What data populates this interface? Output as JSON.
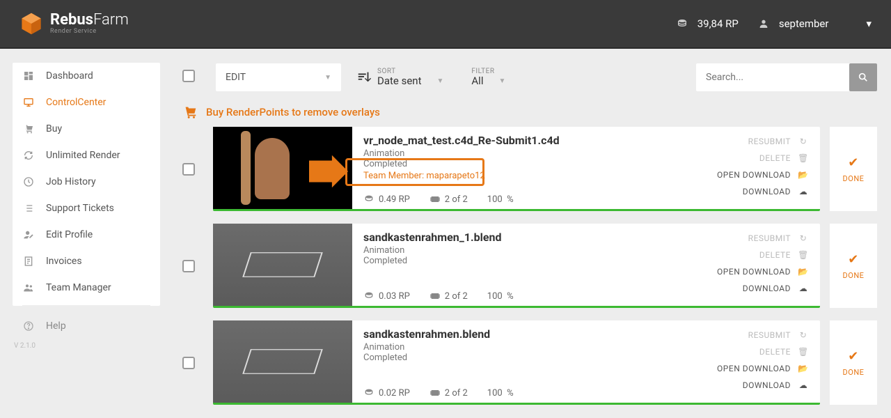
{
  "header": {
    "brand_main": "Rebus",
    "brand_sub": "Farm",
    "brand_tag": "Render Service",
    "balance": "39,84 RP",
    "username": "september"
  },
  "sidebar": {
    "items": [
      {
        "label": "Dashboard",
        "icon": "dashboard"
      },
      {
        "label": "ControlCenter",
        "icon": "monitor",
        "active": true
      },
      {
        "label": "Buy",
        "icon": "cart"
      },
      {
        "label": "Unlimited Render",
        "icon": "cycle"
      },
      {
        "label": "Job History",
        "icon": "history"
      },
      {
        "label": "Support Tickets",
        "icon": "list"
      },
      {
        "label": "Edit Profile",
        "icon": "user-edit"
      },
      {
        "label": "Invoices",
        "icon": "invoice"
      },
      {
        "label": "Team Manager",
        "icon": "team"
      }
    ],
    "help": "Help",
    "version": "V 2.1.0"
  },
  "toolbar": {
    "edit_label": "EDIT",
    "sort_label": "SORT",
    "sort_value": "Date sent",
    "filter_label": "FILTER",
    "filter_value": "All",
    "search_placeholder": "Search..."
  },
  "banner": {
    "text": "Buy RenderPoints to remove overlays"
  },
  "action_labels": {
    "resubmit": "RESUBMIT",
    "delete": "DELETE",
    "open_download": "OPEN DOWNLOAD",
    "download": "DOWNLOAD",
    "done": "DONE"
  },
  "jobs": [
    {
      "title": "vr_node_mat_test.c4d_Re-Submit1.c4d",
      "type": "Animation",
      "status": "Completed",
      "team_member": "Team Member: maparapeto12",
      "rp": "0.49 RP",
      "frames": "2 of 2",
      "progress": "100",
      "unit": "%",
      "thumb": "dark",
      "highlight": true
    },
    {
      "title": "sandkastenrahmen_1.blend",
      "type": "Animation",
      "status": "Completed",
      "team_member": "",
      "rp": "0.03 RP",
      "frames": "2 of 2",
      "progress": "100",
      "unit": "%",
      "thumb": "gray",
      "highlight": false
    },
    {
      "title": "sandkastenrahmen.blend",
      "type": "Animation",
      "status": "Completed",
      "team_member": "",
      "rp": "0.02 RP",
      "frames": "2 of 2",
      "progress": "100",
      "unit": "%",
      "thumb": "gray",
      "highlight": false
    }
  ]
}
